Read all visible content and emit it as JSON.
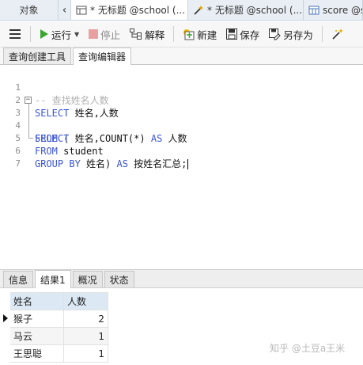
{
  "tabs": {
    "objects": "对象",
    "tab1": "* 无标题 @school (...",
    "tab2": "* 无标题 @school (...",
    "tab3": "score @s"
  },
  "toolbar": {
    "run": "运行",
    "stop": "停止",
    "explain": "解释",
    "new": "新建",
    "save": "保存",
    "save_as": "另存为"
  },
  "subtabs": {
    "builder": "查询创建工具",
    "editor": "查询编辑器"
  },
  "editor": {
    "line_numbers": [
      "1",
      "2",
      "3",
      "4",
      "5",
      "6",
      "7"
    ],
    "line1_comment": "-- 查找姓名人数",
    "line2_kw": "SELECT",
    "line2_rest": " 姓名,人数",
    "line3_kw": "FROM",
    "line3_rest": " (",
    "line4_kw": "SELECT",
    "line4_rest": " 姓名,COUNT(*) ",
    "line4_kw2": "AS",
    "line4_rest2": " 人数",
    "line5_kw": "FROM",
    "line5_rest": " student",
    "line6_kw": "GROUP BY",
    "line6_rest": " 姓名) ",
    "line6_kw2": "AS",
    "line6_rest2": " 按姓名汇总;"
  },
  "result_tabs": {
    "info": "信息",
    "result1": "结果1",
    "overview": "概况",
    "status": "状态"
  },
  "result_grid": {
    "columns": [
      "姓名",
      "人数"
    ],
    "rows": [
      [
        "猴子",
        "2"
      ],
      [
        "马云",
        "1"
      ],
      [
        "王思聪",
        "1"
      ]
    ]
  },
  "watermark": "知乎 @土豆a王米"
}
